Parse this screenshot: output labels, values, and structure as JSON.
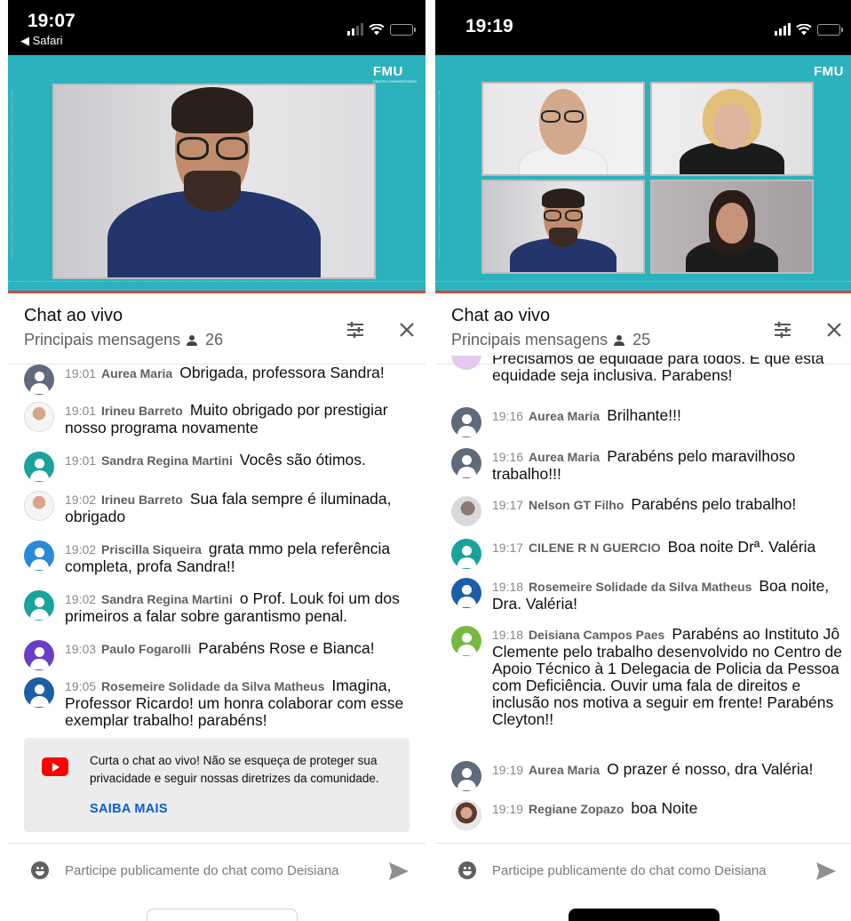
{
  "left": {
    "status": {
      "time": "19:07",
      "back_label": "◀ Safari"
    },
    "video": {
      "brand": "FMU",
      "brand_sub": "CENTRO UNIVERSITÁRIO"
    },
    "header": {
      "title": "Chat ao vivo",
      "subtitle": "Principais mensagens",
      "viewers": "26"
    },
    "messages": [
      {
        "time": "19:01",
        "author": "Aurea Maria",
        "text": "Obrigada, professora Sandra!",
        "avatar_color": "#5f6b7a"
      },
      {
        "time": "19:01",
        "author": "Irineu Barreto",
        "text": "Muito obrigado por prestigiar nosso programa novamente",
        "avatar_color": "photo"
      },
      {
        "time": "19:01",
        "author": "Sandra Regina Martini",
        "text": "Vocês são ótimos.",
        "avatar_color": "#1aa39a"
      },
      {
        "time": "19:02",
        "author": "Irineu Barreto",
        "text": "Sua fala sempre é iluminada, obrigado",
        "avatar_color": "photo"
      },
      {
        "time": "19:02",
        "author": "Priscilla Siqueira",
        "text": "grata mmo pela referência completa, profa Sandra!!",
        "avatar_color": "#2b8ad8"
      },
      {
        "time": "19:02",
        "author": "Sandra Regina Martini",
        "text": "o Prof. Louk foi um dos primeiros a falar sobre garantismo penal.",
        "avatar_color": "#1aa39a"
      },
      {
        "time": "19:03",
        "author": "Paulo Fogarolli",
        "text": "Parabéns Rose e Bianca!",
        "avatar_color": "#6a3fc7"
      },
      {
        "time": "19:05",
        "author": "Rosemeire Solidade da Silva Matheus",
        "text": "Imagina, Professor Ricardo! um honra colaborar com esse exemplar trabalho! parabéns!",
        "avatar_color": "#1d5fa6"
      }
    ],
    "banner": {
      "text": "Curta o chat ao vivo! Não se esqueça de proteger sua privacidade e seguir nossas diretrizes da comunidade.",
      "link": "SAIBA MAIS"
    },
    "input": {
      "placeholder": "Participe publicamente do chat como Deisiana"
    }
  },
  "right": {
    "status": {
      "time": "19:19"
    },
    "video": {
      "brand": "FMU"
    },
    "header": {
      "title": "Chat ao vivo",
      "subtitle": "Principais mensagens",
      "viewers": "25"
    },
    "partial_message": "Precisamos de equidade para todos. E que esta equidade seja inclusiva. Parabens!",
    "messages": [
      {
        "time": "19:16",
        "author": "Aurea Maria",
        "text": "Brilhante!!!",
        "avatar_color": "#5f6b7a"
      },
      {
        "time": "19:16",
        "author": "Aurea Maria",
        "text": "Parabéns pelo maravilhoso trabalho!!!",
        "avatar_color": "#5f6b7a"
      },
      {
        "time": "19:17",
        "author": "Nelson GT Filho",
        "text": "Parabéns pelo trabalho!",
        "avatar_color": "photo"
      },
      {
        "time": "19:17",
        "author": "CILENE R N GUERCIO",
        "text": "Boa noite Drª. Valéria",
        "avatar_color": "#1aa39a"
      },
      {
        "time": "19:18",
        "author": "Rosemeire Solidade da Silva Matheus",
        "text": "Boa noite, Dra. Valéria!",
        "avatar_color": "#1d5fa6"
      },
      {
        "time": "19:18",
        "author": "Deisiana Campos Paes",
        "text": "Parabéns ao Instituto Jô Clemente pelo trabalho desenvolvido no Centro de Apoio Técnico à 1 Delegacia de Policia da Pessoa com Deficiência. Ouvir uma fala de direitos e inclusão nos motiva a seguir em frente! Parabéns Cleyton!!",
        "avatar_color": "#77b843"
      },
      {
        "time": "19:19",
        "author": "Aurea Maria",
        "text": "O prazer é nosso, dra Valéria!",
        "avatar_color": "#5f6b7a"
      },
      {
        "time": "19:19",
        "author": "Regiane Zopazo",
        "text": "boa Noite",
        "avatar_color": "photo"
      }
    ],
    "input": {
      "placeholder": "Participe publicamente do chat como Deisiana"
    }
  }
}
